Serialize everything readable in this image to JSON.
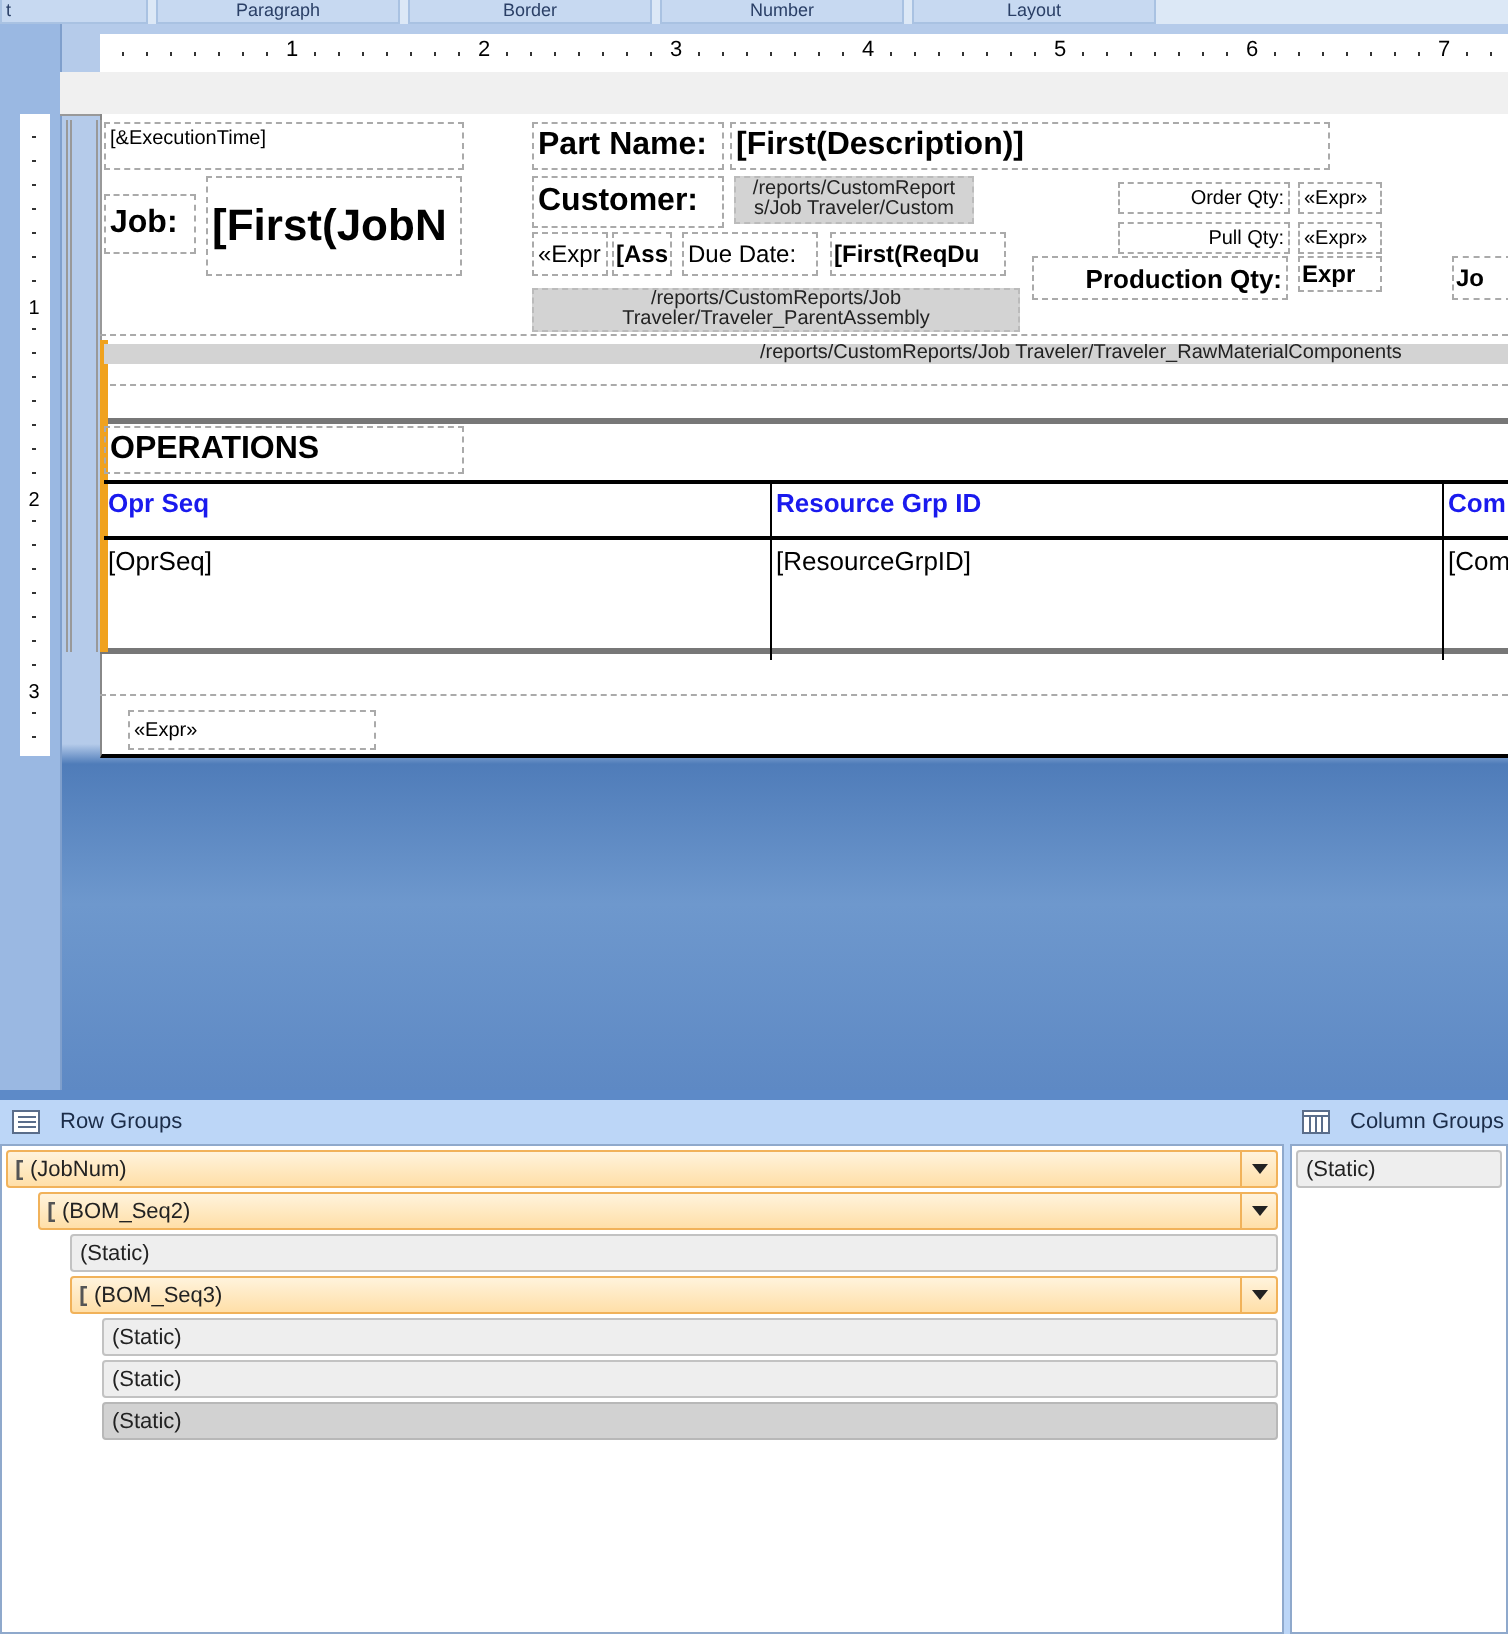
{
  "ribbon_groups": [
    {
      "label": "t"
    },
    {
      "label": "Paragraph"
    },
    {
      "label": "Border"
    },
    {
      "label": "Number"
    },
    {
      "label": "Layout"
    }
  ],
  "ruler": {
    "marks": [
      "1",
      "2",
      "3",
      "4",
      "5",
      "6",
      "7"
    ]
  },
  "vertical_ruler": {
    "marks": [
      "1",
      "2",
      "3"
    ]
  },
  "report_items": [
    {
      "kind": "small",
      "text": "[&ExecutionTime]"
    },
    {
      "kind": "label",
      "text": "Job:"
    },
    {
      "kind": "huge",
      "text": "[First(JobN"
    },
    {
      "kind": "label",
      "text": "Part Name:"
    },
    {
      "kind": "label",
      "text": "[First(Description)]"
    },
    {
      "kind": "label",
      "text": "Customer:"
    },
    {
      "kind": "subreport",
      "lines": [
        "/reports/CustomReport",
        "s/Job Traveler/Custom"
      ]
    },
    {
      "kind": "plain",
      "text": "«Expr"
    },
    {
      "kind": "bold",
      "text": "[Ass"
    },
    {
      "kind": "plain",
      "text": "Due Date:"
    },
    {
      "kind": "bold",
      "text": "[First(ReqDu"
    },
    {
      "kind": "subreport",
      "lines": [
        "/reports/CustomReports/Job",
        "Traveler/Traveler_ParentAssembly"
      ]
    },
    {
      "kind": "tiny-right",
      "text": "Order Qty:"
    },
    {
      "kind": "tiny",
      "text": "«Expr»"
    },
    {
      "kind": "tiny-right",
      "text": "Pull Qty:"
    },
    {
      "kind": "tiny",
      "text": "«Expr»"
    },
    {
      "kind": "bold-right",
      "text": "Production Qty:"
    },
    {
      "kind": "bold",
      "text": "Expr"
    },
    {
      "kind": "bold",
      "text": "Jo"
    },
    {
      "kind": "band",
      "text": "/reports/CustomReports/Job Traveler/Traveler_RawMaterialComponents"
    },
    {
      "kind": "heading",
      "text": "OPERATIONS"
    },
    {
      "kind": "footer",
      "text": "«Expr»"
    }
  ],
  "operations_table": {
    "columns": [
      "Opr Seq",
      "Resource Grp ID",
      "Com"
    ],
    "cells": [
      "[OprSeq]",
      "[ResourceGrpID]",
      "[Com"
    ]
  },
  "row_groups": {
    "title": "Row Groups",
    "items": [
      {
        "kind": "group",
        "label": "(JobNum)",
        "selected": false,
        "children": [
          {
            "kind": "group",
            "label": "(BOM_Seq2)",
            "selected": false,
            "children": [
              {
                "kind": "static",
                "label": "(Static)",
                "selected": false
              },
              {
                "kind": "group",
                "label": "(BOM_Seq3)",
                "selected": false,
                "children": [
                  {
                    "kind": "static",
                    "label": "(Static)",
                    "selected": false
                  },
                  {
                    "kind": "static",
                    "label": "(Static)",
                    "selected": false
                  },
                  {
                    "kind": "static",
                    "label": "(Static)",
                    "selected": true
                  }
                ]
              }
            ]
          }
        ]
      }
    ]
  },
  "column_groups": {
    "title": "Column Groups",
    "items": [
      {
        "kind": "static",
        "label": "(Static)",
        "selected": false
      }
    ]
  }
}
